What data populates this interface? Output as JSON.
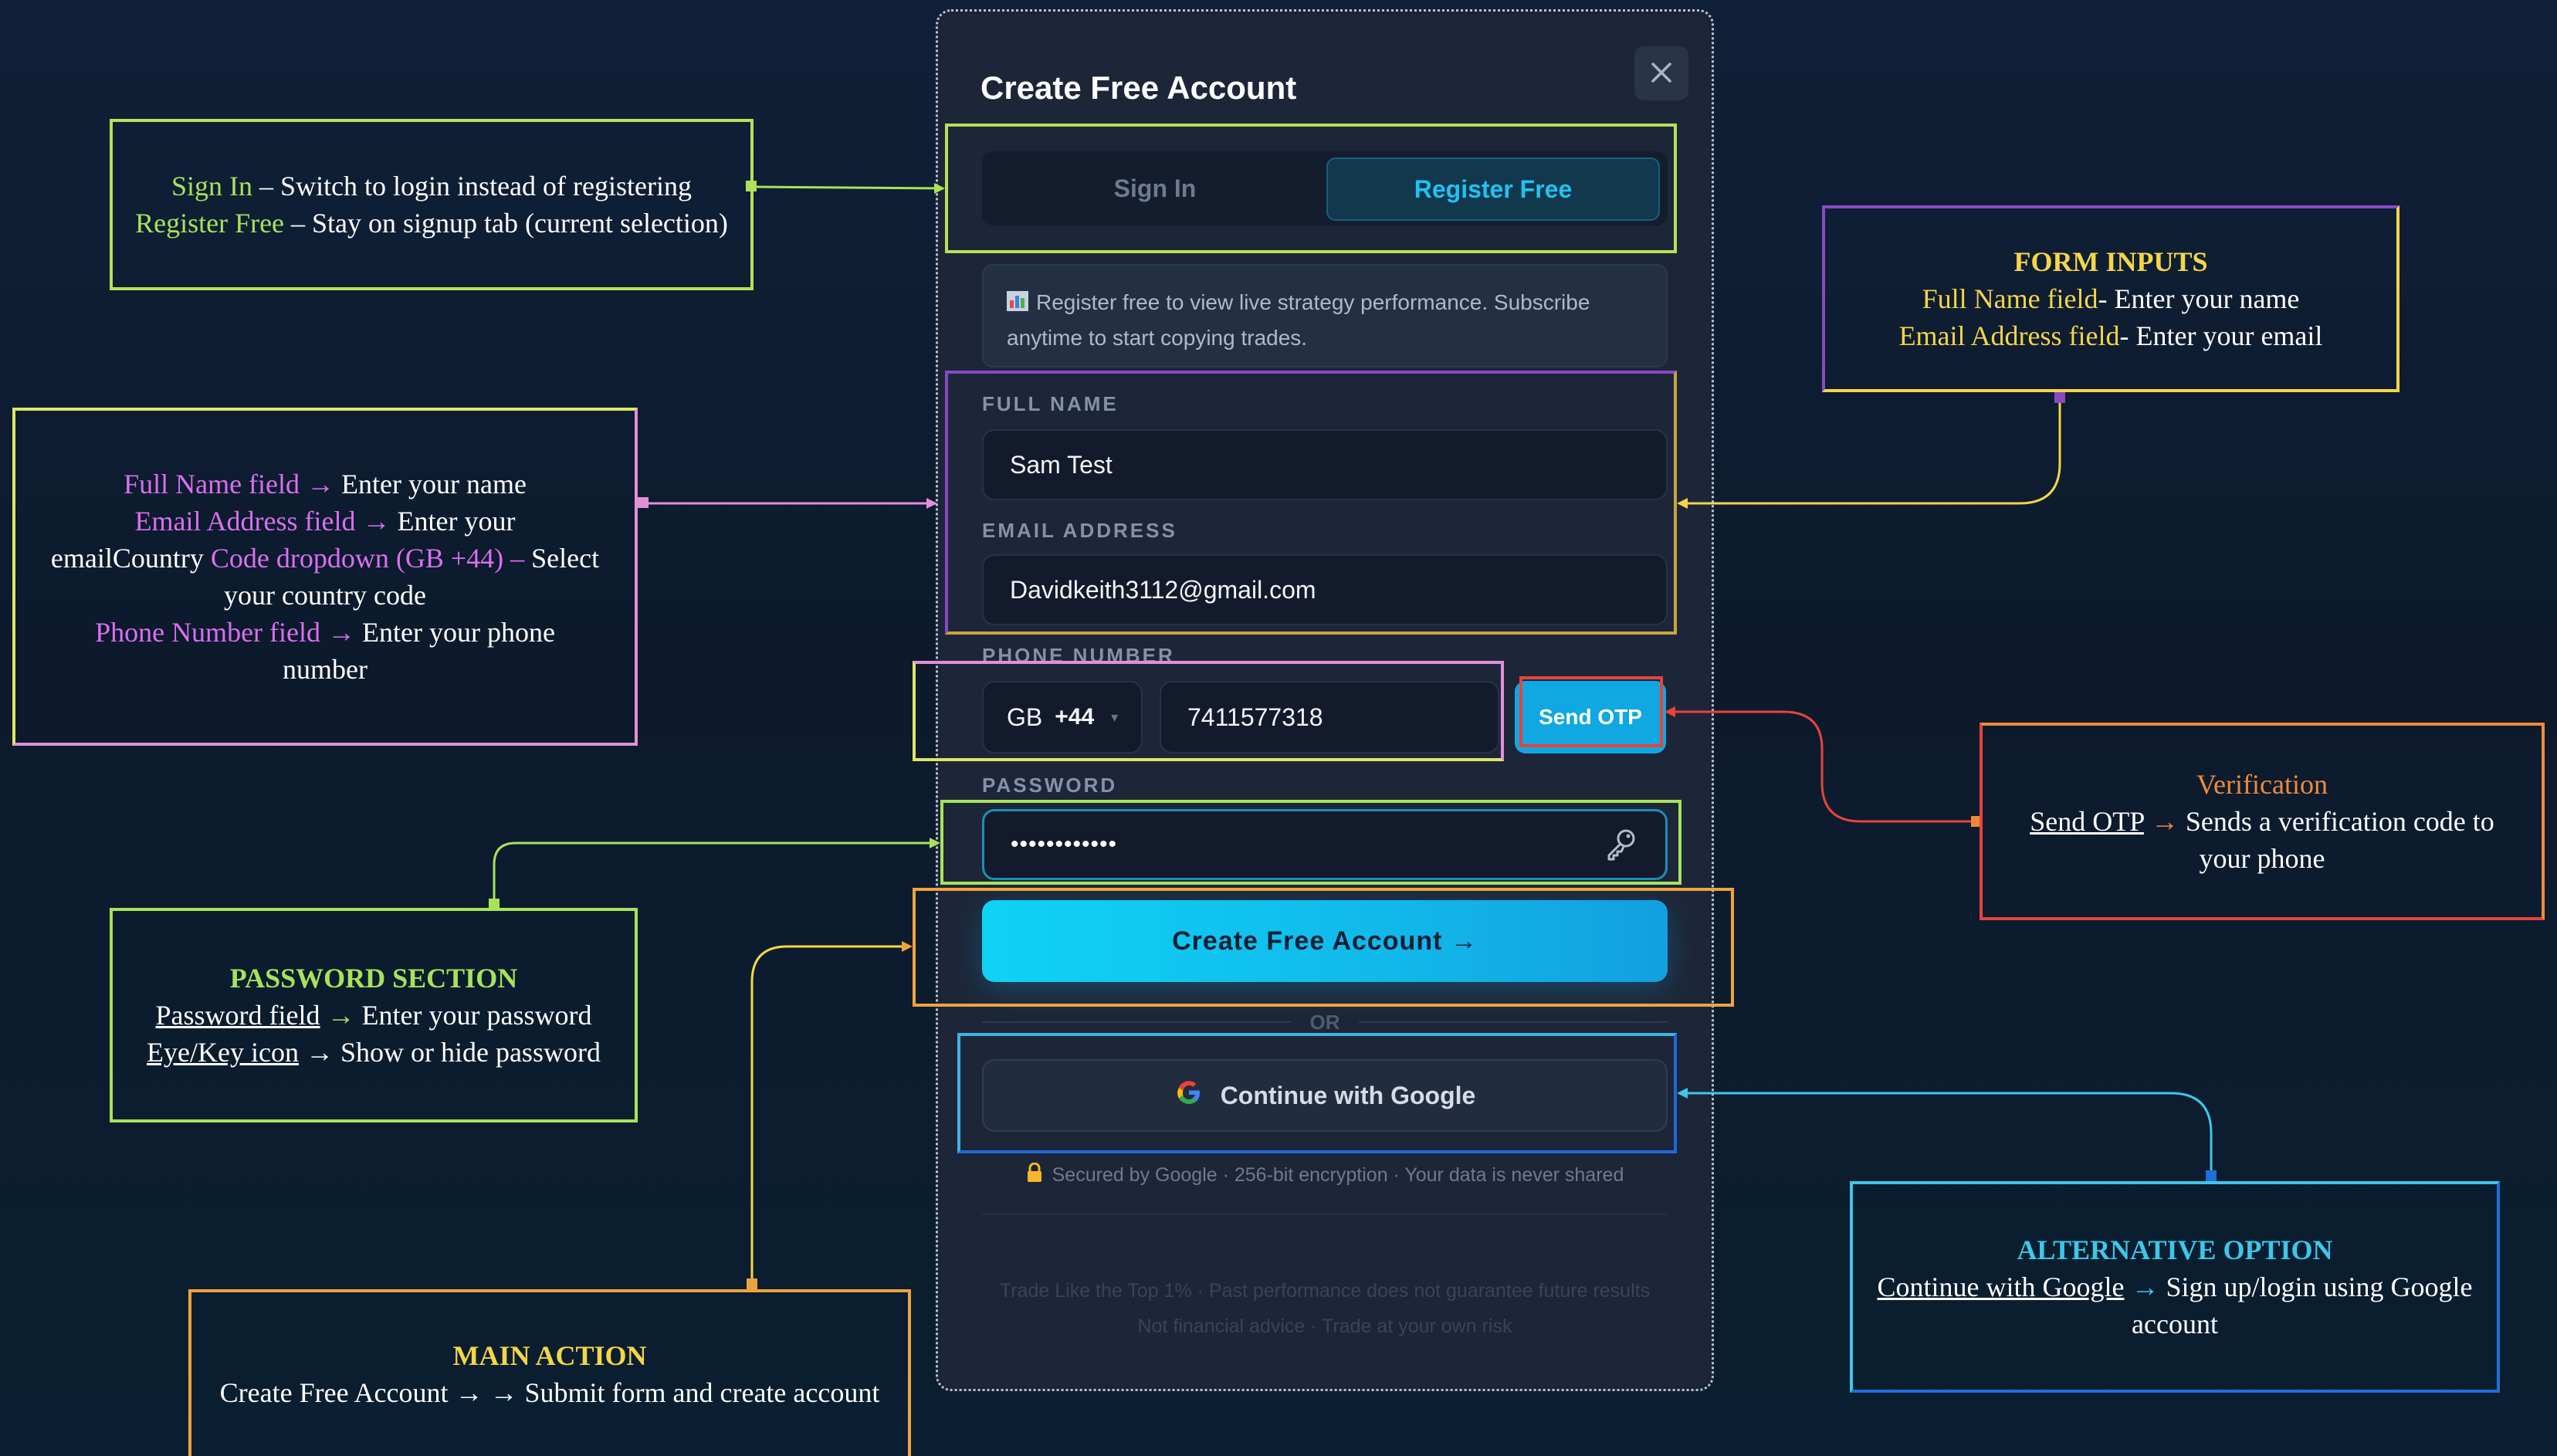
{
  "modal": {
    "title": "Create Free Account",
    "close_icon": "close-icon",
    "tabs": {
      "sign_in": "Sign In",
      "register": "Register Free"
    },
    "info_icon": "chart-icon",
    "info_text_1": "Register free to view live strategy performance. Subscribe",
    "info_text_2": "anytime to start copying trades.",
    "full_name": {
      "label": "FULL NAME",
      "value": "Sam Test"
    },
    "email": {
      "label": "EMAIL ADDRESS",
      "value": "Davidkeith3112@gmail.com"
    },
    "phone": {
      "label": "PHONE NUMBER",
      "country": "GB",
      "code": "+44",
      "value": "7411577318",
      "send_otp": "Send OTP"
    },
    "password": {
      "label": "PASSWORD",
      "value": "••••••••••••",
      "toggle_icon": "key-eye-icon"
    },
    "create_button": "Create Free Account →",
    "divider": "OR",
    "google_button": "Continue with Google",
    "secure_note": "Secured by Google · 256-bit encryption · Your data is never shared",
    "footer_1": "Trade Like the Top 1% · Past performance does not guarantee future results",
    "footer_2": "Not financial advice · Trade at your own risk"
  },
  "annotations": {
    "tabs": {
      "signin_name": "Sign In",
      "signin_desc": " – Switch to login instead of registering",
      "register_name": "Register Free",
      "register_desc": " – Stay on signup tab (current selection)"
    },
    "fields_left": {
      "fullname_name": "Full Name field →",
      "fullname_desc": " Enter your name",
      "email_name": "Email Address field →",
      "email_desc": " Enter your",
      "email_cont": "email",
      "country_pre": "Country",
      "country_name": " Code dropdown (GB +44) –",
      "country_desc": "  Select",
      "country_cont": "your country code",
      "phone_name": "Phone Number field",
      "phone_desc": " Enter your phone",
      "phone_cont": "number"
    },
    "form_inputs": {
      "header": "FORM INPUTS",
      "line1_name": "Full Name field",
      "line1_desc": "- Enter your name",
      "line2_name": "Email Address field",
      "line2_desc": "- Enter your email"
    },
    "verification": {
      "header": "Verification",
      "link": "Send OTP",
      "desc": " Sends a verification code to",
      "desc2": "your phone"
    },
    "password": {
      "header": "PASSWORD SECTION",
      "field_link": "Password field",
      "field_desc": " Enter your password",
      "icon_link": " Eye/Key icon",
      "icon_desc": " Show or hide password"
    },
    "main_action": {
      "header": "MAIN ACTION",
      "desc": "Create Free Account → → Submit form and create account"
    },
    "alternative": {
      "header": "ALTERNATIVE OPTION",
      "link": "Continue with Google",
      "desc": " Sign up/login using Google",
      "desc2": "account"
    }
  },
  "colors": {
    "lime": "#a6e35a",
    "yellow": "#f5d547",
    "magenta": "#d96ff0",
    "orange": "#f08a3c",
    "red": "#e8433a",
    "cyan": "#3dc7e8",
    "blue": "#1f6fd6"
  }
}
